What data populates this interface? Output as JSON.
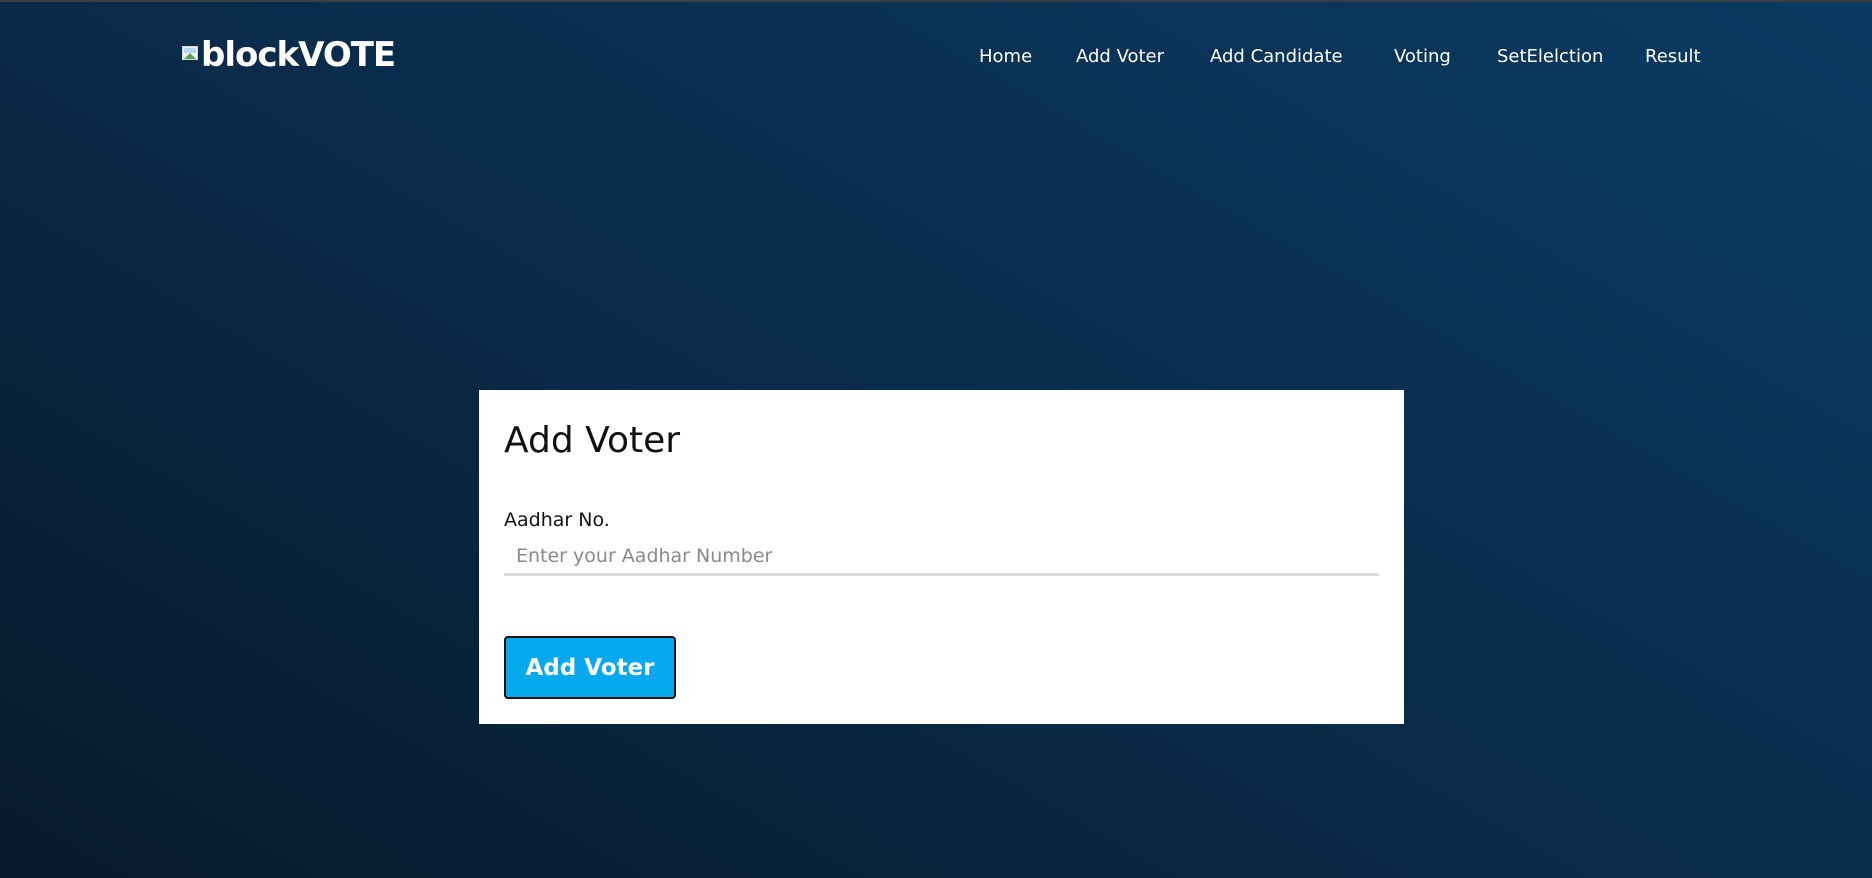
{
  "brand": {
    "name": "blockVOTE",
    "logo_icon": "broken-image-icon"
  },
  "nav": {
    "items": [
      {
        "label": "Home"
      },
      {
        "label": "Add Voter"
      },
      {
        "label": "Add Candidate"
      },
      {
        "label": "Voting"
      },
      {
        "label": "SetElelction"
      },
      {
        "label": "Result"
      }
    ]
  },
  "form": {
    "title": "Add Voter",
    "aadhar_label": "Aadhar No.",
    "aadhar_value": "",
    "aadhar_placeholder": "Enter your Aadhar Number",
    "submit_label": "Add Voter"
  },
  "colors": {
    "background_dark": "#07192b",
    "background_light": "#0a3a62",
    "button": "#06a8ee",
    "card": "#ffffff"
  }
}
